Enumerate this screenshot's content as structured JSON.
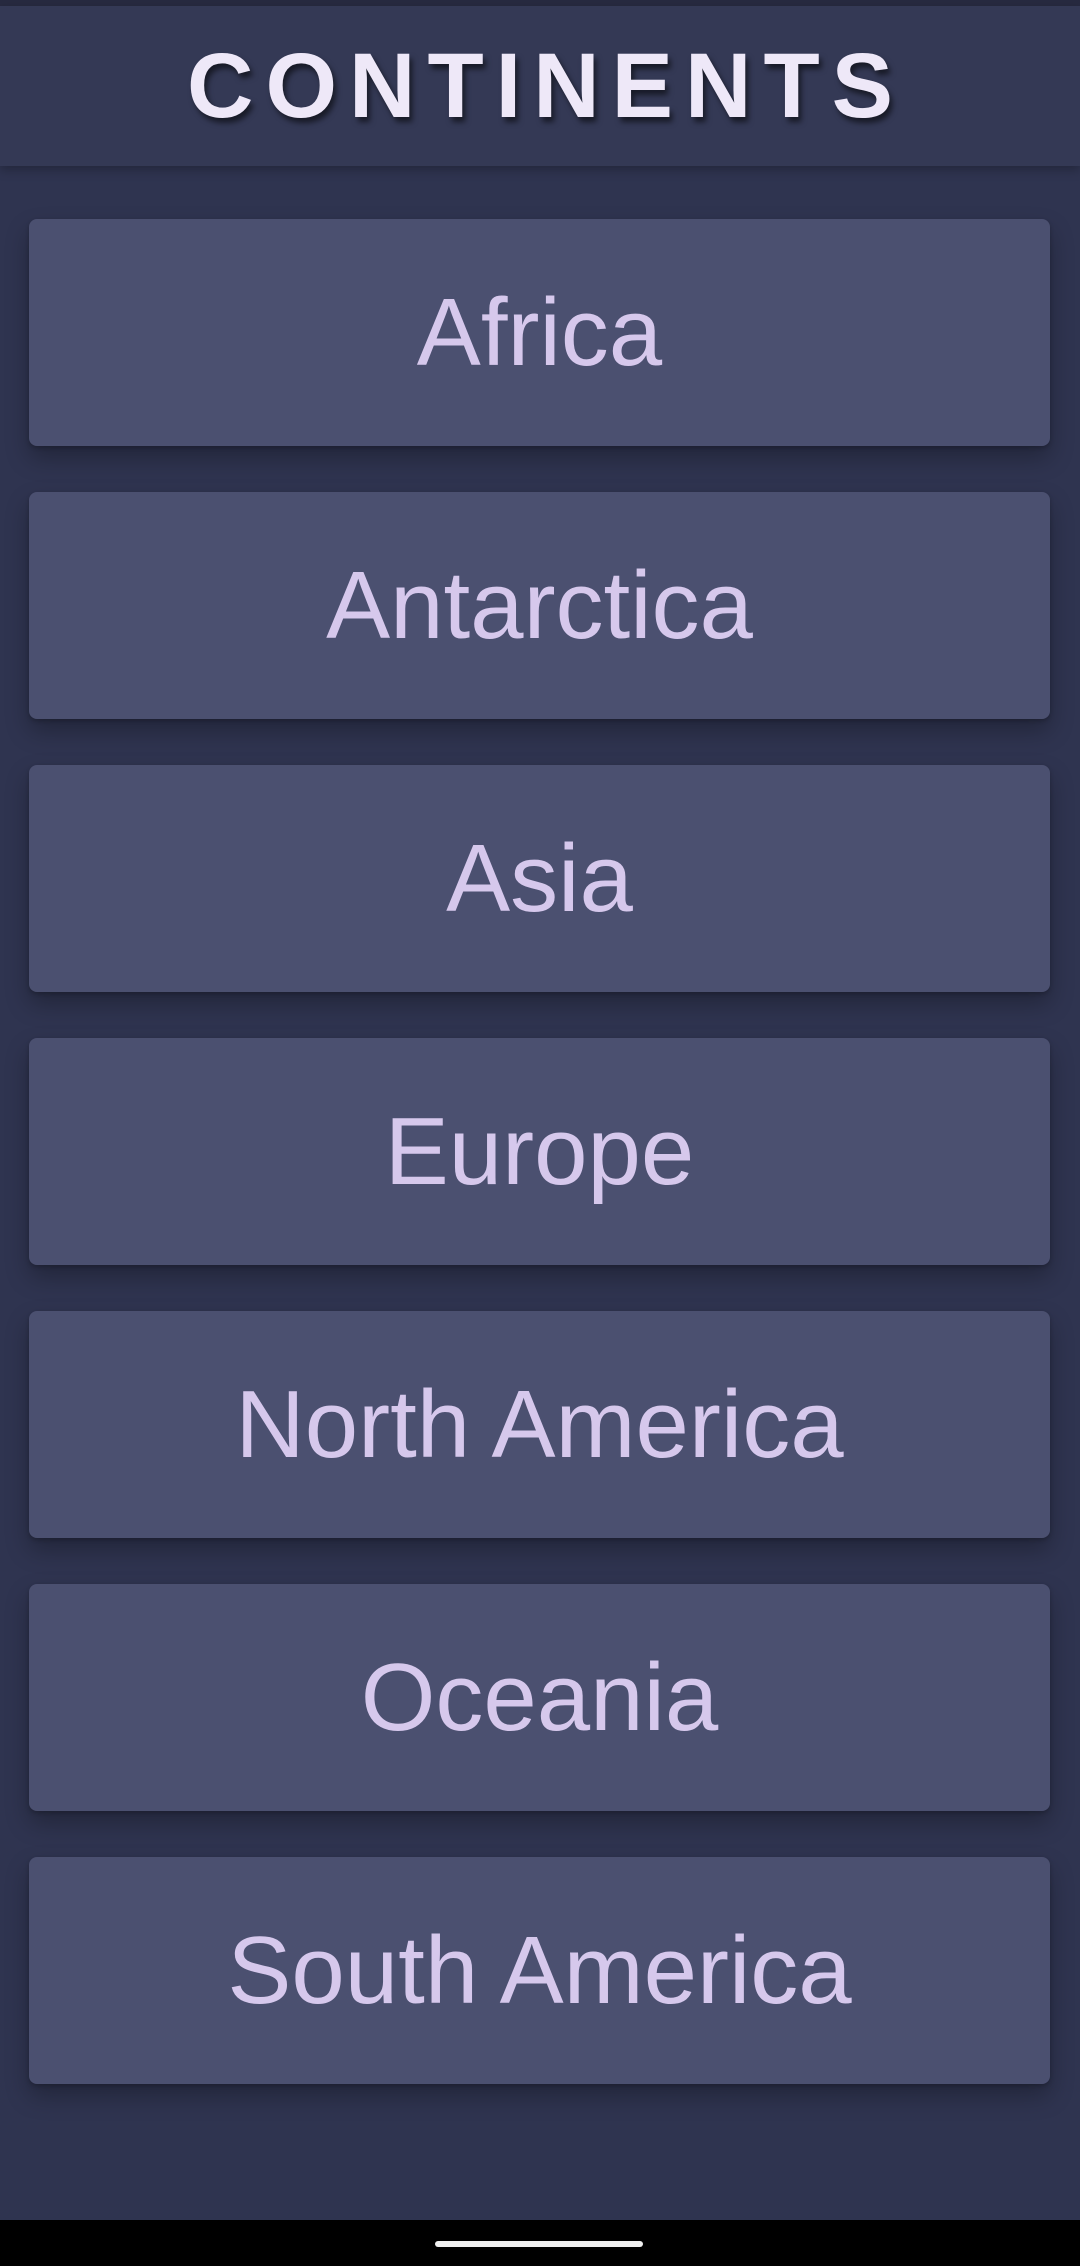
{
  "header": {
    "title": "CONTINENTS"
  },
  "continents": [
    {
      "label": "Africa"
    },
    {
      "label": "Antarctica"
    },
    {
      "label": "Asia"
    },
    {
      "label": "Europe"
    },
    {
      "label": "North America"
    },
    {
      "label": "Oceania"
    },
    {
      "label": "South America"
    }
  ],
  "colors": {
    "background": "#2f3450",
    "header_background": "#343955",
    "item_background": "#4b5070",
    "item_text": "#d6c8ec",
    "title_text": "#eee8f8"
  }
}
